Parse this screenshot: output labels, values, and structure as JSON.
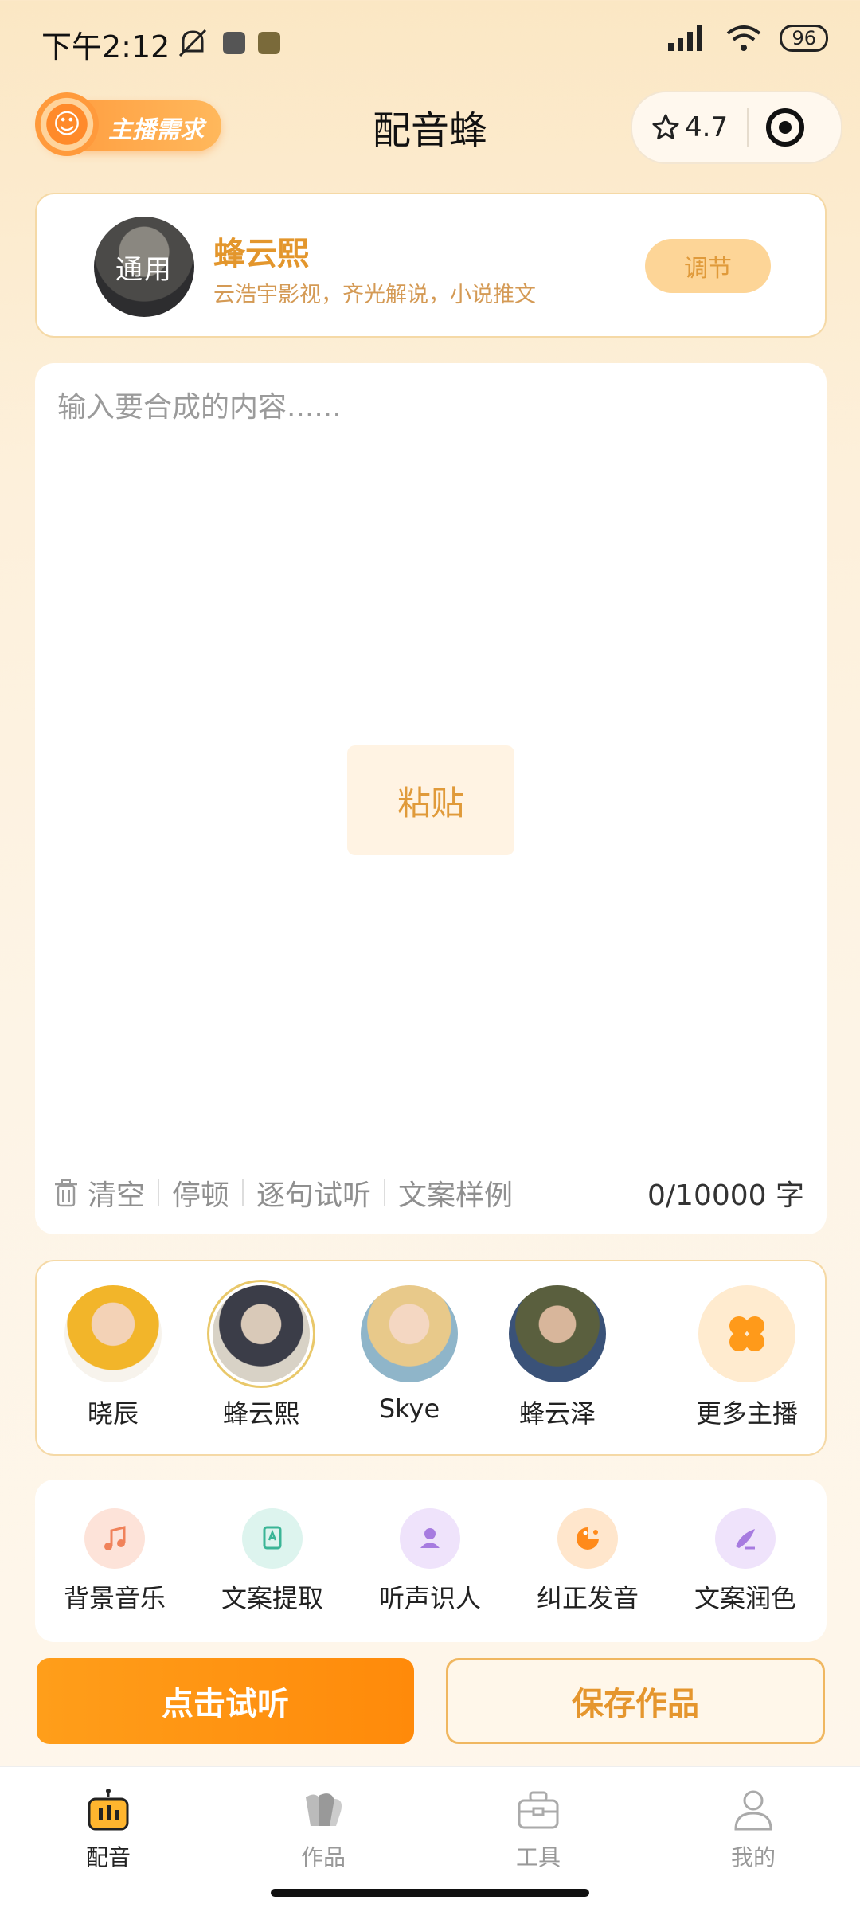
{
  "status_bar": {
    "time": "下午2:12",
    "battery": "96"
  },
  "header": {
    "host_button": "主播需求",
    "title": "配音蜂",
    "rating": "4.7"
  },
  "voice_card": {
    "avatar_label": "通用",
    "name": "蜂云熙",
    "description": "云浩宇影视，齐光解说，小说推文",
    "adjust_button": "调节"
  },
  "editor": {
    "placeholder": "输入要合成的内容......",
    "paste_button": "粘贴",
    "tools": [
      "清空",
      "停顿",
      "逐句试听",
      "文案样例"
    ],
    "counter": "0/10000 字"
  },
  "anchors": {
    "items": [
      {
        "name": "晓辰"
      },
      {
        "name": "蜂云熙"
      },
      {
        "name": "Skye"
      },
      {
        "name": "蜂云泽"
      }
    ],
    "more": "更多主播"
  },
  "features": [
    "背景音乐",
    "文案提取",
    "听声识人",
    "纠正发音",
    "文案润色"
  ],
  "actions": {
    "listen": "点击试听",
    "save": "保存作品"
  },
  "nav": [
    "配音",
    "作品",
    "工具",
    "我的"
  ],
  "colors": {
    "accent": "#FF9A1A",
    "gold_text": "#E3962C"
  }
}
